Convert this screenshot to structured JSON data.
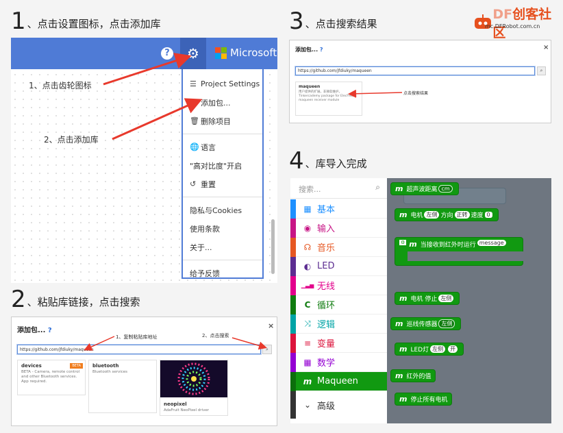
{
  "logo": {
    "brand_a": "DF",
    "brand_b": "创客社区",
    "url": "mc.DFRobot.com.cn"
  },
  "steps": [
    {
      "num": "1",
      "text": "、点击设置图标，点击添加库"
    },
    {
      "num": "2",
      "text": "、粘贴库链接，点击搜索"
    },
    {
      "num": "3",
      "text": "、点击搜索结果"
    },
    {
      "num": "4",
      "text": "、库导入完成"
    }
  ],
  "panel1": {
    "brand": "Microsoft",
    "notes": {
      "gear": "1、点击齿轮图标",
      "add": "2、点击添加库"
    },
    "menu": [
      {
        "icon": "☰",
        "label": "Project Settings"
      },
      {
        "icon": "▤",
        "label": "添加包..."
      },
      {
        "icon": "🗑",
        "label": "删除项目"
      },
      {
        "icon": "🌐",
        "label": "语言"
      },
      {
        "icon": "",
        "label": "\"高对比度\"开启"
      },
      {
        "icon": "↺",
        "label": "重置"
      },
      {
        "icon": "",
        "label": "隐私与Cookies"
      },
      {
        "icon": "",
        "label": "使用条款"
      },
      {
        "icon": "",
        "label": "关于..."
      },
      {
        "icon": "",
        "label": "给予反馈"
      }
    ]
  },
  "dialog": {
    "title": "添加包...",
    "help": "?",
    "close": "×",
    "url": "https://github.com/jfdiuky/maqueen",
    "search_icon": "search-icon"
  },
  "panel2": {
    "notes": {
      "copy": "1、复制粘贴库地址",
      "search": "2、点击搜索"
    },
    "cards": [
      {
        "title": "devices",
        "badge": "BETA",
        "desc": "BETA - Camera, remote control and other Bluetooth services. App required."
      },
      {
        "title": "bluetooth",
        "desc": "Bluetooth services"
      },
      {
        "title": "neopixel",
        "desc": "AdaFruit NeoPixel driver"
      }
    ]
  },
  "panel3": {
    "result": {
      "title": "maqueen",
      "desc": "用户提供的扩展，非微软维护。Tinkercademy package for ElecFreaks maqueen receiver module"
    },
    "note": "点击搜索结果"
  },
  "panel4": {
    "search_placeholder": "搜索...",
    "categories": [
      {
        "icon": "▦",
        "label": "基本",
        "color": "#1e90ff"
      },
      {
        "icon": "◉",
        "label": "输入",
        "color": "#c71585"
      },
      {
        "icon": "☊",
        "label": "音乐",
        "color": "#e65722"
      },
      {
        "icon": "◐",
        "label": "LED",
        "color": "#5c2d91"
      },
      {
        "icon": "▁▃▅",
        "label": "无线",
        "color": "#e3008c"
      },
      {
        "icon": "C",
        "label": "循环",
        "color": "#107c10"
      },
      {
        "icon": "⤨",
        "label": "逻辑",
        "color": "#00a4a6"
      },
      {
        "icon": "≡",
        "label": "变量",
        "color": "#dc143c"
      },
      {
        "icon": "▦",
        "label": "数学",
        "color": "#9400d3"
      },
      {
        "icon": "m",
        "label": "Maqueen",
        "color": "#119911"
      },
      {
        "icon": "⌄",
        "label": "高级",
        "color": "#333333"
      }
    ],
    "blocks": {
      "b1": {
        "m": "m",
        "text": "超声波距离",
        "opt": "cm"
      },
      "b2": {
        "m": "m",
        "a": "电机",
        "o1": "左侧",
        "b": "方向",
        "o2": "正转",
        "c": "速度",
        "val": "0"
      },
      "b3": {
        "m": "m",
        "a": "当接收到红外时运行",
        "var": "message"
      },
      "b4": {
        "m": "m",
        "a": "电机 停止",
        "o1": "左侧"
      },
      "b5": {
        "m": "m",
        "a": "巡线传感器",
        "o1": "左侧"
      },
      "b6": {
        "m": "m",
        "a": "LED灯",
        "o1": "左侧",
        "o2": "开"
      },
      "b7": {
        "m": "m",
        "a": "红外的值"
      },
      "b8": {
        "m": "m",
        "a": "停止所有电机"
      }
    }
  }
}
